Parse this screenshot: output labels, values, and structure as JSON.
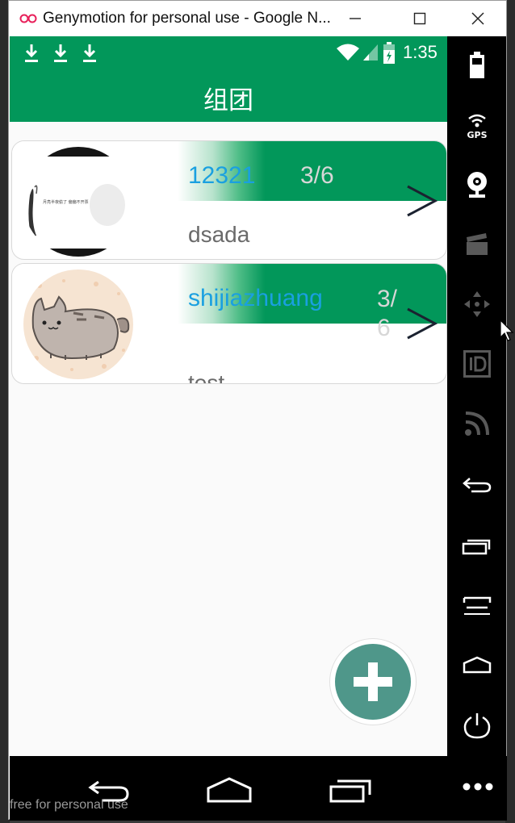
{
  "window": {
    "title": "Genymotion for personal use - Google N..."
  },
  "status_bar": {
    "time": "1:35"
  },
  "app_bar": {
    "title": "组团"
  },
  "groups": [
    {
      "name": "12321",
      "count": "3/6",
      "description": "dsada"
    },
    {
      "name": "shijiazhuang",
      "count": "3/\n6",
      "description": "test"
    }
  ],
  "avatar_caption": "月亮半夜偷了  偏偏不开票",
  "watermark": "free for personal use",
  "sidebar": {
    "gps_label": "GPS"
  },
  "colors": {
    "accent_green": "#02975a",
    "link_blue": "#1aa0e0",
    "fab_teal": "#4f978a"
  },
  "icons": [
    "download-icon",
    "wifi-icon",
    "signal-icon",
    "battery-icon",
    "chevron-right-icon",
    "add-icon",
    "back-icon",
    "home-icon",
    "recents-icon",
    "gps-icon",
    "webcam-icon",
    "capture-icon",
    "dpad-icon",
    "id-icon",
    "rss-icon",
    "menu-icon",
    "power-icon",
    "more-icon"
  ]
}
